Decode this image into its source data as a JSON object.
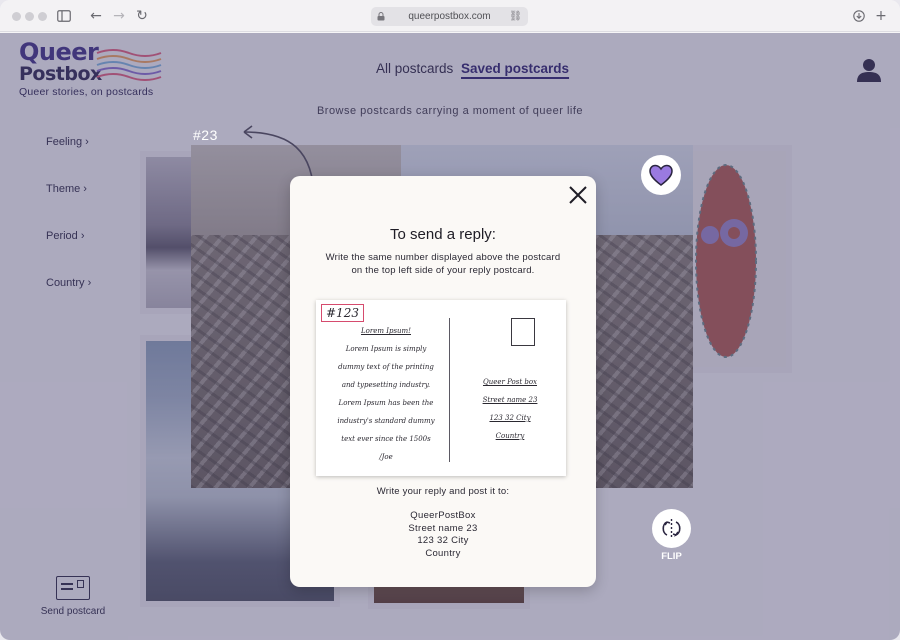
{
  "browser": {
    "url": "queerpostbox.com"
  },
  "logo": {
    "word1": "Queer",
    "word2": "Postbox",
    "tagline": "Queer stories, on postcards"
  },
  "nav": {
    "all": "All postcards",
    "saved": "Saved postcards"
  },
  "subtitle": "Browse postcards carrying a moment of queer life",
  "filters": [
    {
      "label": "Feeling"
    },
    {
      "label": "Theme"
    },
    {
      "label": "Period"
    },
    {
      "label": "Country"
    }
  ],
  "send_postcard": "Send postcard",
  "postcard_number": "#23",
  "flip_label": "FLIP",
  "modal": {
    "title": "To send a reply:",
    "instruction": "Write the same number displayed above the postcard on the top left side of your reply postcard.",
    "example": {
      "number": "#123",
      "message_lines": [
        "Lorem Ipsum!",
        "Lorem Ipsum is simply",
        "dummy text of the printing",
        "and  typesetting industry.",
        "Lorem Ipsum has been the",
        "industry's standard dummy",
        "text ever since the 1500s",
        "/Joe"
      ],
      "address_lines": [
        "Queer Post box",
        "Street name 23",
        "123 32 City",
        "Country"
      ]
    },
    "reply_text": "Write your reply and post it to:",
    "address": [
      "QueerPostBox",
      "Street name 23",
      "123 32 City",
      "Country"
    ]
  },
  "colors": {
    "brand": "#3e2f86",
    "overlay": "#46406e",
    "number_border": "#d64b6e",
    "heart": "#9a7ae0"
  }
}
